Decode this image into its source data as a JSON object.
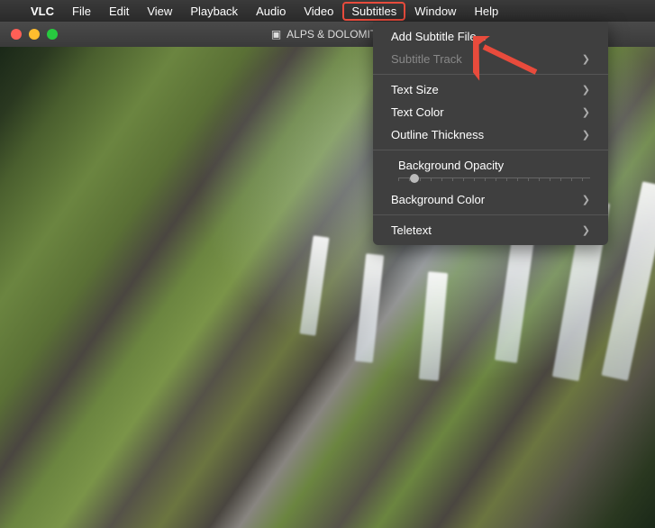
{
  "menubar": {
    "app": "VLC",
    "items": [
      "File",
      "Edit",
      "View",
      "Playback",
      "Audio",
      "Video",
      "Subtitles",
      "Window",
      "Help"
    ],
    "highlighted": "Subtitles"
  },
  "window": {
    "title": "ALPS & DOLOMITE"
  },
  "dropdown": {
    "add_subtitle": "Add Subtitle File...",
    "subtitle_track": "Subtitle Track",
    "text_size": "Text Size",
    "text_color": "Text Color",
    "outline_thickness": "Outline Thickness",
    "background_opacity": "Background Opacity",
    "background_color": "Background Color",
    "teletext": "Teletext"
  }
}
